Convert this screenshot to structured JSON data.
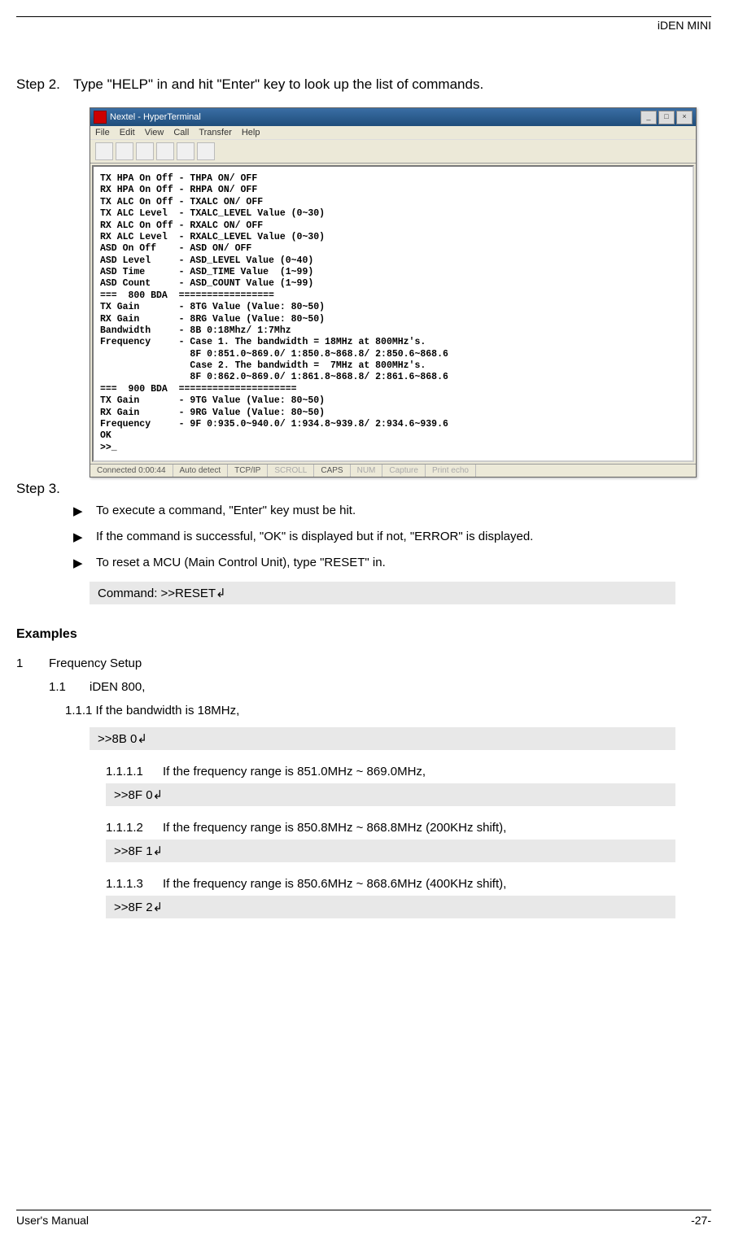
{
  "header": {
    "product": "iDEN MINI"
  },
  "step2": {
    "label": "Step 2.",
    "text": "Type \"HELP\" in and hit \"Enter\" key to look up the list of commands."
  },
  "terminal": {
    "title": "Nextel - HyperTerminal",
    "menus": [
      "File",
      "Edit",
      "View",
      "Call",
      "Transfer",
      "Help"
    ],
    "content": "TX HPA On Off - THPA ON/ OFF\nRX HPA On Off - RHPA ON/ OFF\nTX ALC On Off - TXALC ON/ OFF\nTX ALC Level  - TXALC_LEVEL Value (0~30)\nRX ALC On Off - RXALC ON/ OFF\nRX ALC Level  - RXALC_LEVEL Value (0~30)\nASD On Off    - ASD ON/ OFF\nASD Level     - ASD_LEVEL Value (0~40)\nASD Time      - ASD_TIME Value  (1~99)\nASD Count     - ASD_COUNT Value (1~99)\n===  800 BDA  =================\nTX Gain       - 8TG Value (Value: 80~50)\nRX Gain       - 8RG Value (Value: 80~50)\nBandwidth     - 8B 0:18Mhz/ 1:7Mhz\nFrequency     - Case 1. The bandwidth = 18MHz at 800MHz's.\n                8F 0:851.0~869.0/ 1:850.8~868.8/ 2:850.6~868.6\n                Case 2. The bandwidth =  7MHz at 800MHz's.\n                8F 0:862.0~869.0/ 1:861.8~868.8/ 2:861.6~868.6\n===  900 BDA  =====================\nTX Gain       - 9TG Value (Value: 80~50)\nRX Gain       - 9RG Value (Value: 80~50)\nFrequency     - 9F 0:935.0~940.0/ 1:934.8~939.8/ 2:934.6~939.6\nOK\n>>_",
    "status": {
      "connected": "Connected 0:00:44",
      "detect": "Auto detect",
      "protocol": "TCP/IP",
      "scroll": "SCROLL",
      "caps": "CAPS",
      "num": "NUM",
      "capture": "Capture",
      "print": "Print echo"
    }
  },
  "step3": {
    "label": "Step 3.",
    "bullets": [
      "To execute a command, \"Enter\" key must be hit.",
      "If the command is successful, \"OK\" is displayed but if not, \"ERROR\" is displayed.",
      "To reset a MCU (Main Control Unit), type \"RESET\" in."
    ],
    "command": "Command: >>RESET↲"
  },
  "examples": {
    "heading": "Examples",
    "n1": "1",
    "t1": "Frequency Setup",
    "n11": "1.1",
    "t11": "iDEN 800,",
    "t111": "1.1.1 If the bandwidth is 18MHz,",
    "cmd111": ">>8B 0↲",
    "sub": [
      {
        "n": "1.1.1.1",
        "t": "If the frequency range is 851.0MHz ~ 869.0MHz,",
        "cmd": ">>8F 0↲"
      },
      {
        "n": "1.1.1.2",
        "t": "If the frequency range is 850.8MHz ~ 868.8MHz (200KHz shift),",
        "cmd": ">>8F 1↲"
      },
      {
        "n": "1.1.1.3",
        "t": "If the frequency range is 850.6MHz ~ 868.6MHz (400KHz shift),",
        "cmd": ">>8F 2↲"
      }
    ]
  },
  "footer": {
    "left": "User's Manual",
    "right": "-27-"
  },
  "bullet_glyph": "▶"
}
